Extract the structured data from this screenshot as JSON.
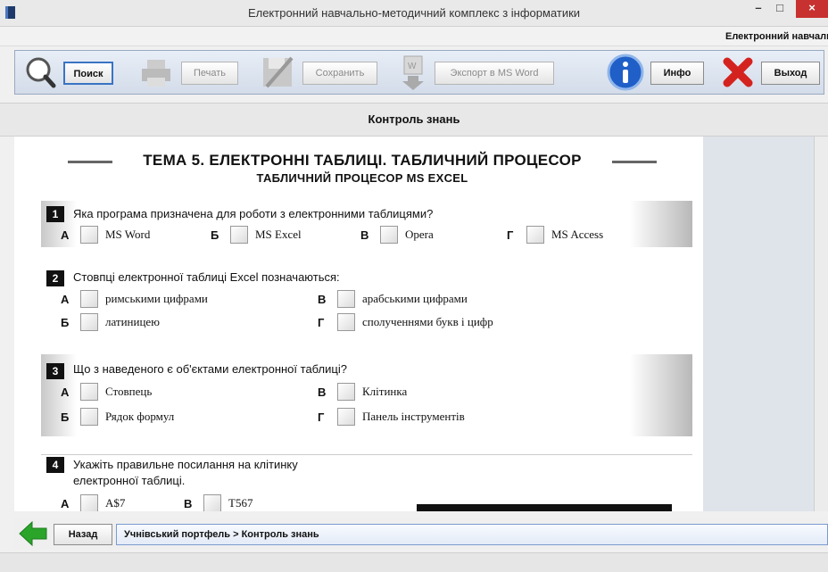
{
  "window": {
    "title": "Електронний навчально-методичний комплекс з інформатики",
    "min_label": "–",
    "max_label": "□",
    "close_label": "×"
  },
  "subheader": {
    "text": "Електронний навчальн"
  },
  "toolbar": {
    "search_label": "Поиск",
    "print_label": "Печать",
    "save_label": "Сохранить",
    "export_label": "Экспорт в MS Word",
    "info_label": "Инфо",
    "exit_label": "Выход"
  },
  "section": {
    "title": "Контроль знань"
  },
  "document": {
    "title": "ТЕМА 5. ЕЛЕКТРОННІ ТАБЛИЦІ. ТАБЛИЧНИЙ ПРОЦЕСОР",
    "subtitle": "ТАБЛИЧНИЙ ПРОЦЕСОР MS EXCEL",
    "questions": [
      {
        "num": "1",
        "text": "Яка програма призначена для роботи з електронними таблицями?",
        "options": [
          {
            "letter": "А",
            "text": "MS Word"
          },
          {
            "letter": "Б",
            "text": "MS Excel"
          },
          {
            "letter": "В",
            "text": "Opera"
          },
          {
            "letter": "Г",
            "text": "MS Access"
          }
        ]
      },
      {
        "num": "2",
        "text": "Стовпці електронної таблиці Excel позначаються:",
        "options": [
          {
            "letter": "А",
            "text": "римськими цифрами"
          },
          {
            "letter": "В",
            "text": "арабськими цифрами"
          },
          {
            "letter": "Б",
            "text": "латиницею"
          },
          {
            "letter": "Г",
            "text": "сполученнями букв і цифр"
          }
        ]
      },
      {
        "num": "3",
        "text": "Що з наведеного є об'єктами електронної таблиці?",
        "options": [
          {
            "letter": "А",
            "text": "Стовпець"
          },
          {
            "letter": "В",
            "text": "Клітинка"
          },
          {
            "letter": "Б",
            "text": "Рядок формул"
          },
          {
            "letter": "Г",
            "text": "Панель інструментів"
          }
        ]
      },
      {
        "num": "4",
        "text_line1": "Укажіть правильне посилання на клітинку",
        "text_line2": "електронної таблиці.",
        "options": [
          {
            "letter": "А",
            "text": "A$7"
          },
          {
            "letter": "В",
            "text": "T567"
          }
        ]
      }
    ]
  },
  "statusbar": {
    "back_label": "Назад",
    "breadcrumb": "Учнівський портфель > Контроль знань"
  },
  "colors": {
    "accent": "#3a73c4",
    "close": "#c7312f",
    "back_arrow": "#2aa52a"
  }
}
